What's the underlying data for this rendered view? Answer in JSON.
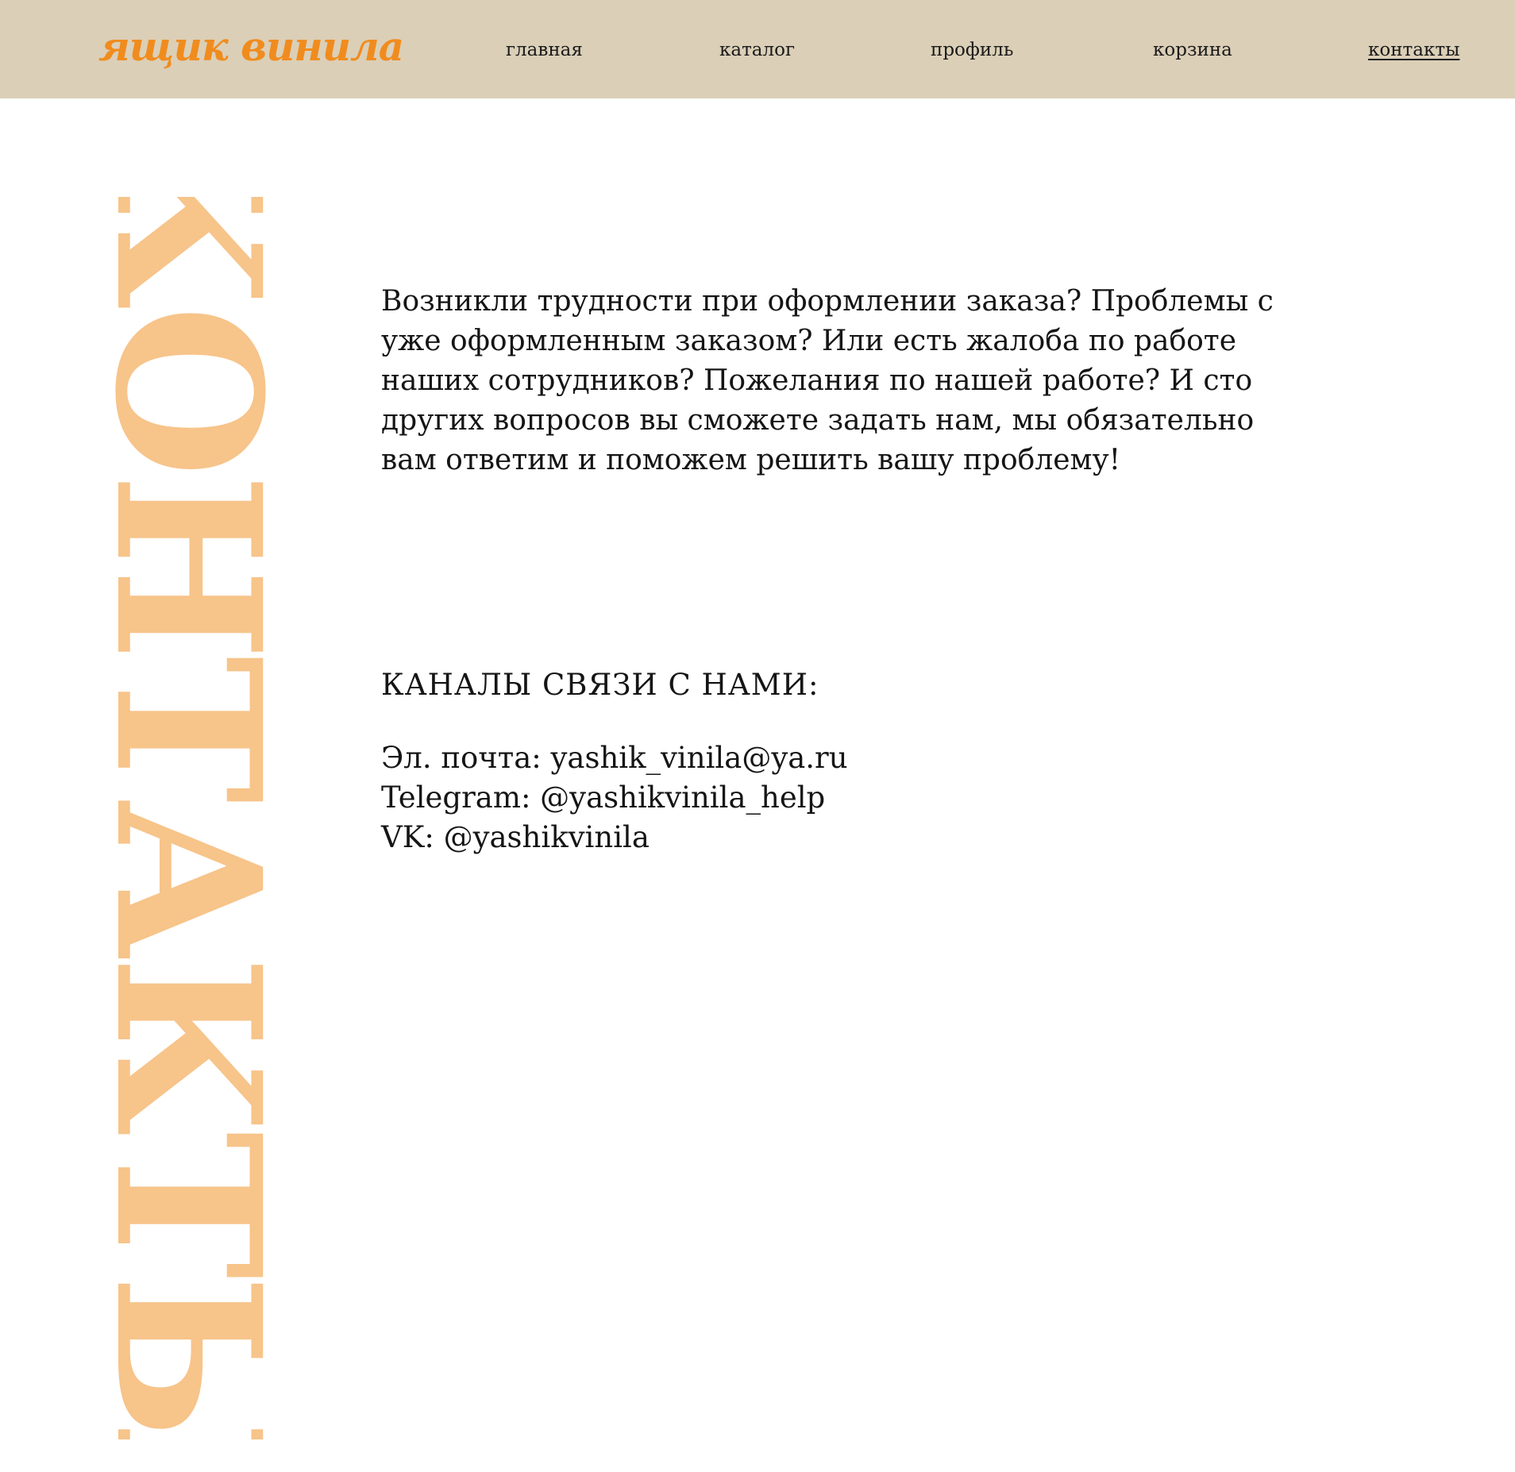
{
  "header": {
    "logo": "ящик винила",
    "nav": [
      {
        "label": "главная",
        "active": false
      },
      {
        "label": "каталог",
        "active": false
      },
      {
        "label": "профиль",
        "active": false
      },
      {
        "label": "корзина",
        "active": false
      },
      {
        "label": "контакты",
        "active": true
      }
    ]
  },
  "page": {
    "vertical_title": "контакты",
    "intro": "Возникли трудности при оформлении заказа? Проблемы с уже оформленным заказом? Или есть жалоба по работе наших сотрудников? Пожелания по нашей работе? И сто других вопросов вы сможете задать нам, мы обязательно вам ответим и поможем решить вашу проблему!",
    "channels_title": "КАНАЛЫ СВЯЗИ С НАМИ:",
    "channels": [
      "Эл. почта: yashik_vinila@ya.ru",
      "Telegram: @yashikvinila_help",
      "VK: @yashikvinila"
    ]
  },
  "colors": {
    "header_bg": "#dbcfb7",
    "logo": "#f08c1e",
    "vertical_title": "#f7c48a",
    "text": "#151515"
  }
}
